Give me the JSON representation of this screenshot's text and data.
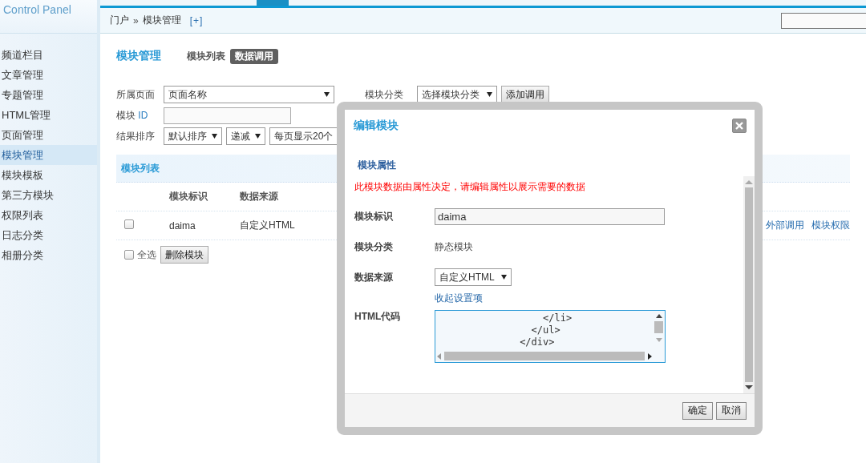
{
  "sidebar": {
    "title": "Control Panel",
    "items": [
      {
        "label": "频道栏目",
        "selected": false
      },
      {
        "label": "文章管理",
        "selected": false
      },
      {
        "label": "专题管理",
        "selected": false
      },
      {
        "label": "HTML管理",
        "selected": false
      },
      {
        "label": "页面管理",
        "selected": false
      },
      {
        "label": "模块管理",
        "selected": true
      },
      {
        "label": "模块模板",
        "selected": false
      },
      {
        "label": "第三方模块",
        "selected": false
      },
      {
        "label": "权限列表",
        "selected": false
      },
      {
        "label": "日志分类",
        "selected": false
      },
      {
        "label": "相册分类",
        "selected": false
      }
    ]
  },
  "breadcrumb": {
    "items": [
      "门户",
      "模块管理"
    ],
    "separator": "»",
    "add_link": "[+]"
  },
  "page": {
    "title": "模块管理",
    "tabs": [
      {
        "label": "模块列表",
        "selected": false
      },
      {
        "label": "数据调用",
        "selected": true
      }
    ]
  },
  "filters": {
    "page_label": "所属页面",
    "page_select": "页面名称",
    "category_label": "模块分类",
    "category_select": "选择模块分类",
    "add_button": "添加调用",
    "id_label": "模块 ID",
    "sort_label": "结果排序",
    "sort_selects": [
      "默认排序",
      "递减",
      "每页显示20个"
    ]
  },
  "table": {
    "title": "模块列表",
    "columns": [
      "模块标识",
      "数据来源"
    ],
    "rows": [
      {
        "checked": false,
        "cells": [
          "daima",
          "自定义HTML"
        ],
        "actions": [
          "外部调用",
          "模块权限"
        ]
      }
    ],
    "select_all": {
      "label": "全选",
      "checked": false
    },
    "delete_button": "删除模块"
  },
  "dialog": {
    "title": "编辑模块",
    "section": "模块属性",
    "notice": "此模块数据由属性决定，请编辑属性以展示需要的数据",
    "fields": [
      {
        "kind": "input",
        "label": "模块标识",
        "value": "daima"
      },
      {
        "kind": "text",
        "label": "模块分类",
        "value": "静态模块"
      },
      {
        "kind": "select",
        "label": "数据来源",
        "value": "自定义HTML"
      },
      {
        "kind": "link",
        "value": "收起设置项"
      },
      {
        "kind": "code",
        "label": "HTML代码",
        "lines": [
          "                  </li>",
          "                </ul>",
          "              </div>"
        ]
      }
    ],
    "buttons": [
      "确定",
      "取消"
    ]
  }
}
